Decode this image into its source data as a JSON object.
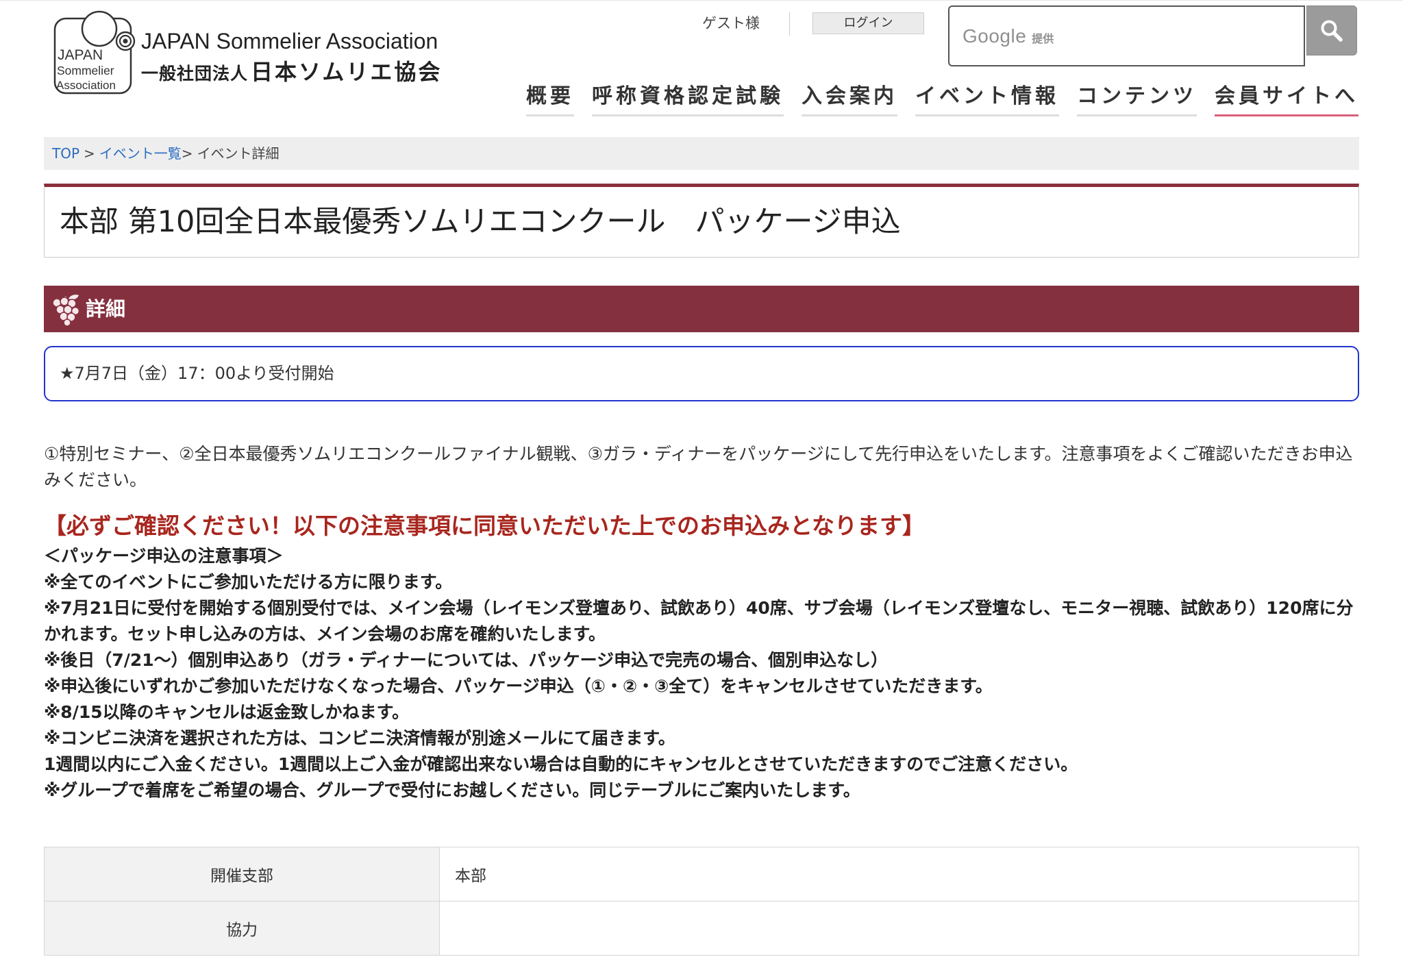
{
  "header": {
    "logo": {
      "line1": "JAPAN",
      "line2": "Sommelier",
      "line3": "Association"
    },
    "org_name_en": "JAPAN Sommelier Association",
    "org_name_prefix": "一般社団法人",
    "org_name_ja": "日本ソムリエ協会",
    "guest_label": "ゲスト様",
    "login_label": "ログイン",
    "search": {
      "value": "",
      "watermark_brand": "Google",
      "watermark_suffix": "提供"
    }
  },
  "nav": {
    "items": [
      {
        "label": "概要"
      },
      {
        "label": "呼称資格認定試験"
      },
      {
        "label": "入会案内"
      },
      {
        "label": "イベント情報"
      },
      {
        "label": "コンテンツ"
      },
      {
        "label": "会員サイトへ",
        "highlighted": true
      }
    ]
  },
  "breadcrumb": {
    "home": "TOP",
    "sep1": ">",
    "events": "イベント一覧",
    "sep2": ">",
    "current": "イベント詳細"
  },
  "event_title": "本部 第10回全日本最優秀ソムリエコンクール　パッケージ申込",
  "section_heading": "詳細",
  "notice": "★7月7日（金）17：00より受付開始",
  "intro": "①特別セミナー、②全日本最優秀ソムリエコンクールファイナル観戦、③ガラ・ディナーをパッケージにして先行申込をいたします。注意事項をよくご確認いただきお申込みください。",
  "warning": "【必ずご確認ください！以下の注意事項に同意いただいた上でのお申込みとなります】",
  "notes": {
    "heading": "＜パッケージ申込の注意事項＞",
    "items": [
      "※全てのイベントにご参加いただける方に限ります。",
      "※7月21日に受付を開始する個別受付では、メイン会場（レイモンズ登壇あり、試飲あり）40席、サブ会場（レイモンズ登壇なし、モニター視聴、試飲あり）120席に分かれます。セット申し込みの方は、メイン会場のお席を確約いたします。",
      "※後日（7/21〜）個別申込あり（ガラ・ディナーについては、パッケージ申込で完売の場合、個別申込なし）",
      "※申込後にいずれかご参加いただけなくなった場合、パッケージ申込（①・②・③全て）をキャンセルさせていただきます。",
      "※8/15以降のキャンセルは返金致しかねます。",
      "※コンビニ決済を選択された方は、コンビニ決済情報が別途メールにて届きます。",
      "1週間以内にご入金ください。1週間以上ご入金が確認出来ない場合は自動的にキャンセルとさせていただきますのでご注意ください。",
      "※グループで着席をご希望の場合、グループで受付にお越しください。同じテーブルにご案内いたします。"
    ]
  },
  "details_table": {
    "rows": [
      {
        "label": "開催支部",
        "value": "本部"
      },
      {
        "label": "協力",
        "value": ""
      }
    ]
  },
  "icons": {
    "logo": "sommelier-logo",
    "search_button": "search-icon",
    "section": "grapes-icon"
  },
  "colors": {
    "brand": "#85303f",
    "brand_line": "#8b2f3e",
    "nav_accent": "#d9607a",
    "link": "#2a6cc0",
    "warning": "#a8261e",
    "notice_border": "#2233cc"
  }
}
